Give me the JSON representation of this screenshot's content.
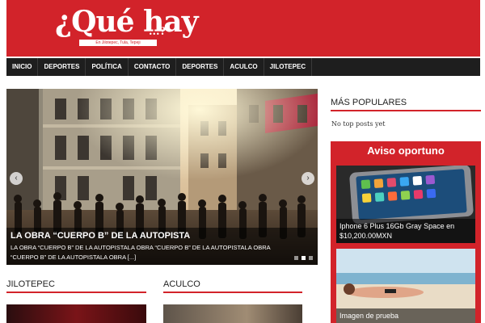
{
  "header": {
    "logo_title": "¿Qué hay",
    "logo_dots": "...?",
    "logo_tagline": "En Jilotepec, Tula, Tepeji"
  },
  "nav": {
    "items": [
      "INICIO",
      "DEPORTES",
      "POLÍTICA",
      "CONTACTO",
      "DEPORTES",
      "ACULCO",
      "JILOTEPEC"
    ]
  },
  "slider": {
    "title": "LA OBRA “CUERPO B” DE LA AUTOPISTA",
    "excerpt": "LA OBRA “CUERPO B” DE LA AUTOPISTALA OBRA “CUERPO B” DE LA AUTOPISTALA OBRA “CUERPO B” DE LA AUTOPISTALA OBRA [...]",
    "prev_icon": "chevron-left-icon",
    "next_icon": "chevron-right-icon",
    "prev_glyph": "‹",
    "next_glyph": "›",
    "dot_count": 3,
    "active_dot": 1
  },
  "sections": {
    "jilotepec": "JILOTEPEC",
    "aculco": "ACULCO"
  },
  "sidebar": {
    "popular_title": "MÁS POPULARES",
    "no_posts": "No top posts yet",
    "aviso_title": "Aviso oportuno",
    "ads": [
      {
        "caption": "Iphone 6 Plus 16Gb Gray Space en $10,200.00MXN"
      },
      {
        "caption": "Imagen de prueba"
      }
    ]
  },
  "colors": {
    "brand_red": "#d2232a",
    "nav_dark": "#1e1e1e"
  }
}
